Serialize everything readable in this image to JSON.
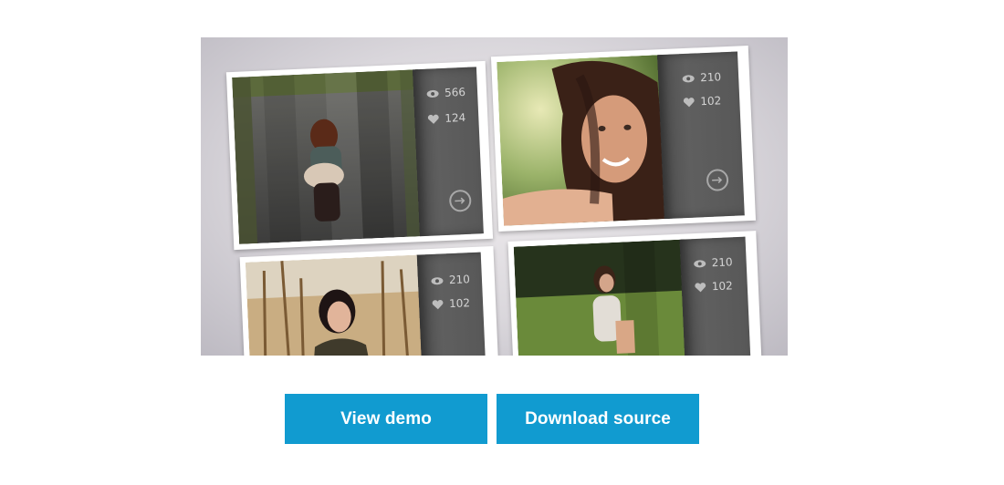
{
  "gallery": {
    "cards": [
      {
        "views": "566",
        "likes": "124"
      },
      {
        "views": "210",
        "likes": "102"
      },
      {
        "views": "210",
        "likes": "102"
      },
      {
        "views": "210",
        "likes": "102"
      }
    ]
  },
  "actions": {
    "view_demo_label": "View demo",
    "download_label": "Download source"
  },
  "colors": {
    "button_bg": "#119bd0",
    "panel_bg": "#585858",
    "page_bg": "#ffffff"
  },
  "icons": [
    "eye-icon",
    "heart-icon",
    "arrow-right-circle-icon"
  ]
}
